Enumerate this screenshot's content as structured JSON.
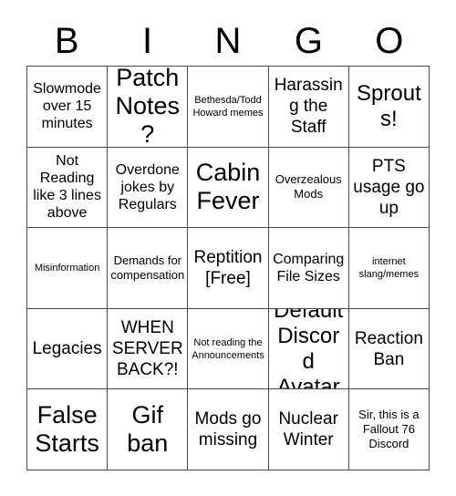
{
  "card": {
    "header_letters": [
      "B",
      "I",
      "N",
      "G",
      "O"
    ],
    "grid_size": 5,
    "colors": {
      "background": "#ffffff",
      "text": "#000000",
      "grid_line": "#4a4a4a"
    },
    "cells": [
      {
        "text": "Slowmode over 15 minutes",
        "size": "sm"
      },
      {
        "text": "Patch Notes?",
        "size": "xl"
      },
      {
        "text": "Bethesda/Todd Howard memes",
        "size": "xxs"
      },
      {
        "text": "Harassing the Staff",
        "size": "md"
      },
      {
        "text": "Sprouts!",
        "size": "lg"
      },
      {
        "text": "Not Reading like 3 lines above",
        "size": "sm"
      },
      {
        "text": "Overdone jokes by Regulars",
        "size": "sm"
      },
      {
        "text": "Cabin Fever",
        "size": "xl"
      },
      {
        "text": "Overzealous Mods",
        "size": "xs"
      },
      {
        "text": "PTS usage go up",
        "size": "md"
      },
      {
        "text": "Misinformation",
        "size": "xxs"
      },
      {
        "text": "Demands for compensation",
        "size": "xs"
      },
      {
        "text": "Reptition [Free]",
        "size": "md"
      },
      {
        "text": "Comparing File Sizes",
        "size": "sm"
      },
      {
        "text": "internet slang/memes",
        "size": "xxs"
      },
      {
        "text": "Legacies",
        "size": "md"
      },
      {
        "text": "WHEN SERVER BACK?!",
        "size": "md"
      },
      {
        "text": "Not reading the Announcements",
        "size": "xxs"
      },
      {
        "text": "Default Discord Avatar",
        "size": "lg"
      },
      {
        "text": "Reaction Ban",
        "size": "md"
      },
      {
        "text": "False Starts",
        "size": "xl"
      },
      {
        "text": "Gif ban",
        "size": "xl"
      },
      {
        "text": "Mods go missing",
        "size": "md"
      },
      {
        "text": "Nuclear Winter",
        "size": "md"
      },
      {
        "text": "Sir, this is a Fallout 76 Discord",
        "size": "xs"
      }
    ]
  }
}
